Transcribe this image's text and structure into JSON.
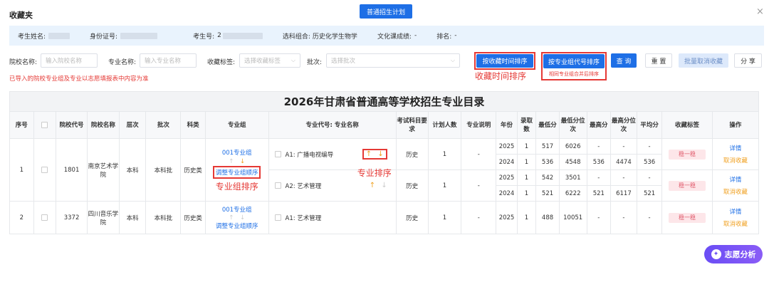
{
  "header": {
    "title": "收藏夹",
    "plan_tab": "普通招生计划",
    "close_glyph": "×"
  },
  "info": {
    "name_label": "考生姓名:",
    "id_label": "身份证号:",
    "exam_no_label": "考生号:",
    "exam_no_prefix": "2",
    "subjects_label": "选科组合:",
    "subjects_value": "历史化学生物学",
    "score_label": "文化课成绩:",
    "score_value": "-",
    "rank_label": "排名:",
    "rank_value": "-"
  },
  "filters": {
    "school_label": "院校名称:",
    "school_placeholder": "输入院校名称",
    "major_label": "专业名称:",
    "major_placeholder": "输入专业名称",
    "tag_label": "收藏标签:",
    "tag_placeholder": "选择收藏标签",
    "batch_label": "批次:",
    "batch_placeholder": "选择批次"
  },
  "actions": {
    "sort_time": "按收藏时间排序",
    "sort_group": "按专业组代号排序",
    "sort_group_note": "相同专业组合并后排序",
    "search": "查 询",
    "reset": "重 置",
    "batch_cancel": "批量取消收藏",
    "share": "分 享"
  },
  "annotations": {
    "time_sort": "收藏时间排序",
    "major_sort": "专业排序",
    "group_sort": "专业组排序"
  },
  "warning": "已导入的院校专业组及专业以志愿填报表中内容为准",
  "table": {
    "title": "2026年甘肃省普通高等学校招生专业目录",
    "headers": [
      "序号",
      "",
      "院校代号",
      "院校名称",
      "层次",
      "批次",
      "科类",
      "专业组",
      "专业代号: 专业名称",
      "考试科目要求",
      "计划人数",
      "专业说明",
      "年份",
      "录取数",
      "最低分",
      "最低分位次",
      "最高分",
      "最高分位次",
      "平均分",
      "收藏标签",
      "操作"
    ],
    "rows": [
      {
        "seq": "1",
        "code": "1801",
        "school": "南京艺术学院",
        "level": "本科",
        "batch": "本科批",
        "category": "历史类",
        "group": "001专业组",
        "group_adjust": "调整专业组顺序",
        "majors": [
          {
            "name": "A1: 广播电视编导",
            "req": "历史",
            "plan": "1",
            "note": "-",
            "tag": "稳一稳",
            "years": [
              {
                "year": "2025",
                "count": "1",
                "min": "517",
                "min_rank": "6026",
                "max": "-",
                "max_rank": "-",
                "avg": "-"
              },
              {
                "year": "2024",
                "count": "1",
                "min": "536",
                "min_rank": "4548",
                "max": "536",
                "max_rank": "4474",
                "avg": "536"
              }
            ],
            "op1": "详情",
            "op2": "取消收藏"
          },
          {
            "name": "A2: 艺术管理",
            "req": "历史",
            "plan": "1",
            "note": "-",
            "tag": "稳一稳",
            "years": [
              {
                "year": "2025",
                "count": "1",
                "min": "542",
                "min_rank": "3501",
                "max": "-",
                "max_rank": "-",
                "avg": "-"
              },
              {
                "year": "2024",
                "count": "1",
                "min": "521",
                "min_rank": "6222",
                "max": "521",
                "max_rank": "6117",
                "avg": "521"
              }
            ],
            "op1": "详情",
            "op2": "取消收藏"
          }
        ]
      },
      {
        "seq": "2",
        "code": "3372",
        "school": "四川音乐学院",
        "level": "本科",
        "batch": "本科批",
        "category": "历史类",
        "group": "001专业组",
        "group_adjust": "调整专业组顺序",
        "majors": [
          {
            "name": "A1: 艺术管理",
            "req": "历史",
            "plan": "1",
            "note": "-",
            "tag": "稳一稳",
            "years": [
              {
                "year": "2025",
                "count": "1",
                "min": "488",
                "min_rank": "10051",
                "max": "-",
                "max_rank": "-",
                "avg": "-"
              }
            ],
            "op1": "详情",
            "op2": "取消收藏"
          }
        ]
      }
    ]
  },
  "fab": {
    "label": "志愿分析"
  },
  "icons": {
    "up_arrow": "↑",
    "down_arrow": "↓",
    "dropdown": "⌵"
  },
  "colors": {
    "accent": "#1e6fe6",
    "annotation": "#e53935",
    "tag_bg": "#fde6e9",
    "orange": "#f0a020"
  }
}
